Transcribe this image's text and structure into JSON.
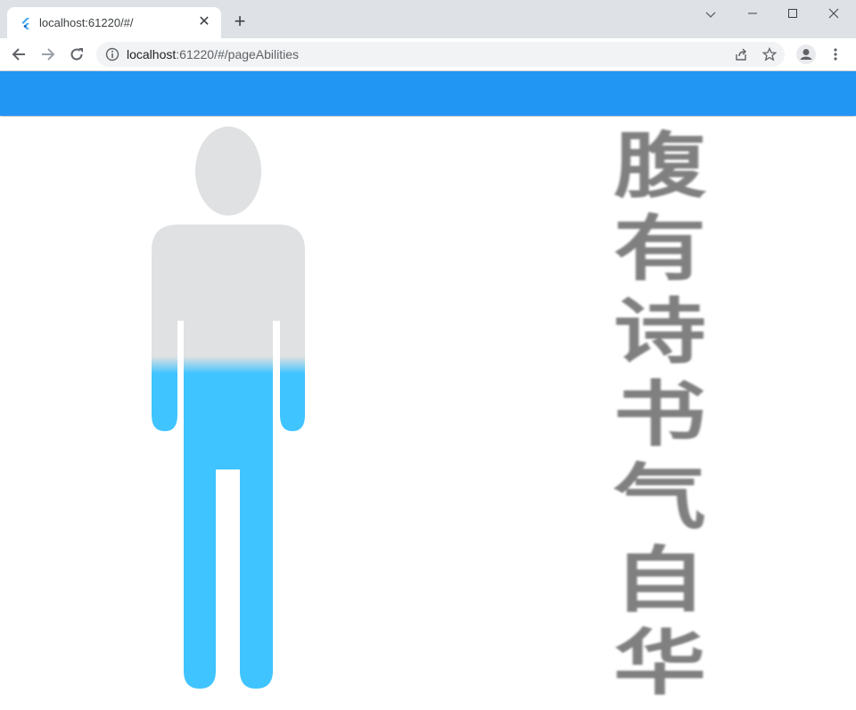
{
  "browser": {
    "tab_title": "localhost:61220/#/",
    "url_host": "localhost",
    "url_rest": ":61220/#/pageAbilities"
  },
  "poem": {
    "chars": [
      "腹",
      "有",
      "诗",
      "书",
      "气",
      "自",
      "华"
    ]
  },
  "colors": {
    "app_bar": "#2196f3",
    "figure_base": "#dfe1e2",
    "figure_fill": "#40c4ff",
    "poem_text": "#808080"
  },
  "figure": {
    "fill_level_percent": 58
  }
}
